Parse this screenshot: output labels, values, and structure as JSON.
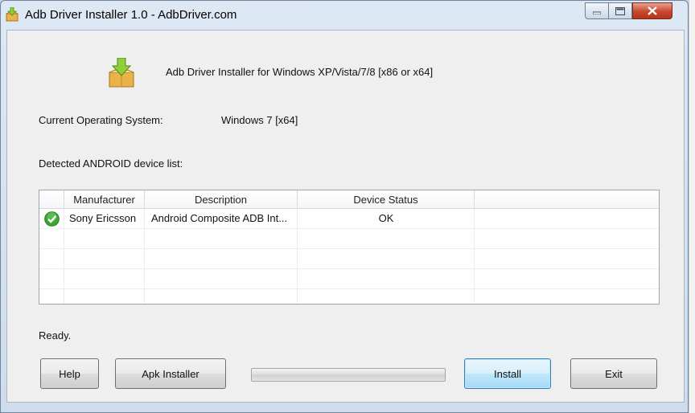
{
  "window": {
    "title": "Adb Driver Installer 1.0  -  AdbDriver.com"
  },
  "header": {
    "text": "Adb Driver Installer for Windows XP/Vista/7/8 [x86 or x64]"
  },
  "system": {
    "os_label": "Current Operating System:",
    "os_value": "Windows 7  [x64]"
  },
  "devices": {
    "label": "Detected ANDROID device list:",
    "columns": [
      "",
      "Manufacturer",
      "Description",
      "Device Status",
      ""
    ],
    "rows": [
      {
        "manufacturer": "Sony Ericsson",
        "description": "Android Composite ADB Int...",
        "status": "OK"
      }
    ]
  },
  "status": {
    "text": "Ready."
  },
  "progress": {
    "fraction": 0
  },
  "buttons": {
    "help": "Help",
    "apk": "Apk Installer",
    "install": "Install",
    "exit": "Exit"
  },
  "icons": {
    "app": "package-arrow-icon",
    "row_status": "green-check-icon"
  },
  "colors": {
    "check": "#3aa530",
    "close_button": "#c7472d",
    "install_border": "#3c7fb1"
  }
}
